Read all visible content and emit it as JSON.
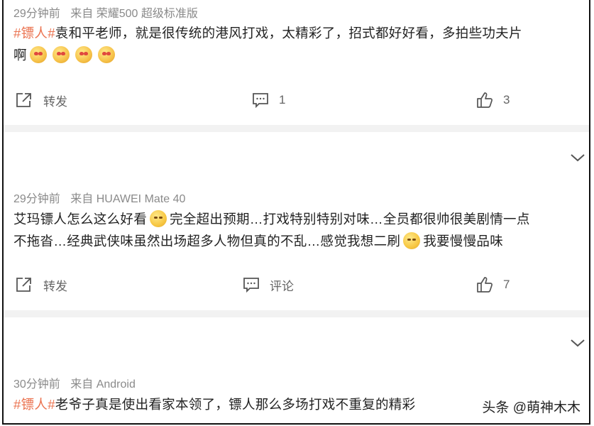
{
  "posts": [
    {
      "time": "29分钟前",
      "source": "来自 荣耀500 超级标准版",
      "tag": "#镖人#",
      "text_line1": "袁和平老师，就是很传统的港风打戏，太精彩了，招式都好好看，多拍些功夫片",
      "text_line2": "啊",
      "emoji_icons": [
        "love-face-emoji",
        "love-face-emoji",
        "love-face-emoji",
        "love-face-emoji"
      ],
      "repost_label": "转发",
      "comment_label": "1",
      "like_count": "3"
    },
    {
      "time": "29分钟前",
      "source": "来自 HUAWEI Mate 40",
      "text_line1_a": "艾玛镖人怎么这么好看",
      "text_line1_b": "完全超出预期…打戏特别特别对味…全员都很帅很美剧情一点",
      "text_line2_a": "不拖沓…经典武侠味虽然出场超多人物但真的不乱…感觉我想二刷",
      "text_line2_b": "我要慢慢品味",
      "repost_label": "转发",
      "comment_label": "评论",
      "like_count": "7"
    },
    {
      "time": "30分钟前",
      "source": "来自 Android",
      "tag": "#镖人#",
      "text": "老爷子真是使出看家本领了，镖人那么多场打戏不重复的精彩"
    }
  ],
  "watermark": "头条 @萌神木木",
  "colors": {
    "topic_tag": "#eb7350",
    "meta_text": "#8a8a8a",
    "separator": "#f2f2f2"
  }
}
